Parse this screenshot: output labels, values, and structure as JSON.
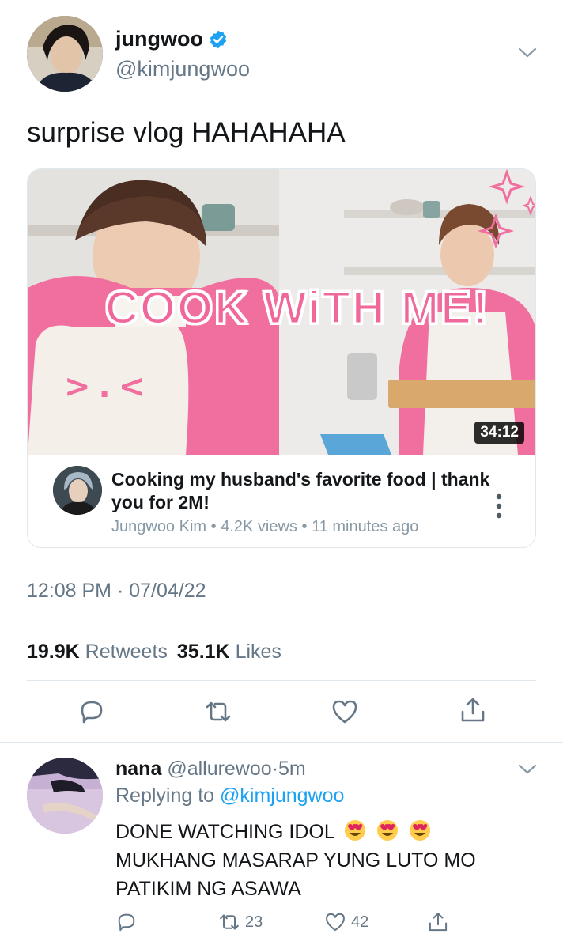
{
  "tweet": {
    "author_name": "jungwoo",
    "author_handle": "@kimjungwoo",
    "verified_icon": "verified-badge-icon",
    "text": "surprise vlog HAHAHAHA",
    "timestamp": "12:08 PM · 07/04/22",
    "retweets_count": "19.9K",
    "retweets_label": "Retweets",
    "likes_count": "35.1K",
    "likes_label": "Likes"
  },
  "video_card": {
    "thumbnail_text": "COOK WiTH ME!",
    "thumbnail_emoticon": ">.<",
    "duration": "34:12",
    "title": "Cooking my husband's favorite food | thank you for 2M!",
    "channel": "Jungwoo Kim",
    "views": "4.2K views",
    "age": "11 minutes ago",
    "separator": "•"
  },
  "actions": [
    "reply-icon",
    "retweet-icon",
    "like-icon",
    "share-icon"
  ],
  "reply": {
    "author_name": "nana",
    "author_handle": "@allurewoo",
    "time": "5m",
    "dot": "·",
    "replying_label": "Replying to",
    "replying_to": "@kimjungwoo",
    "line1": "DONE WATCHING IDOL",
    "line2": "MUKHANG MASARAP YUNG LUTO MO",
    "line3": "PATIKIM NG ASAWA",
    "emoji": "heart-eyes-emoji",
    "retweets": "23",
    "likes": "42"
  },
  "colors": {
    "accent": "#1da1f2",
    "muted": "#657786",
    "text": "#14171a",
    "thumbnail_pink": "#f0679a"
  }
}
